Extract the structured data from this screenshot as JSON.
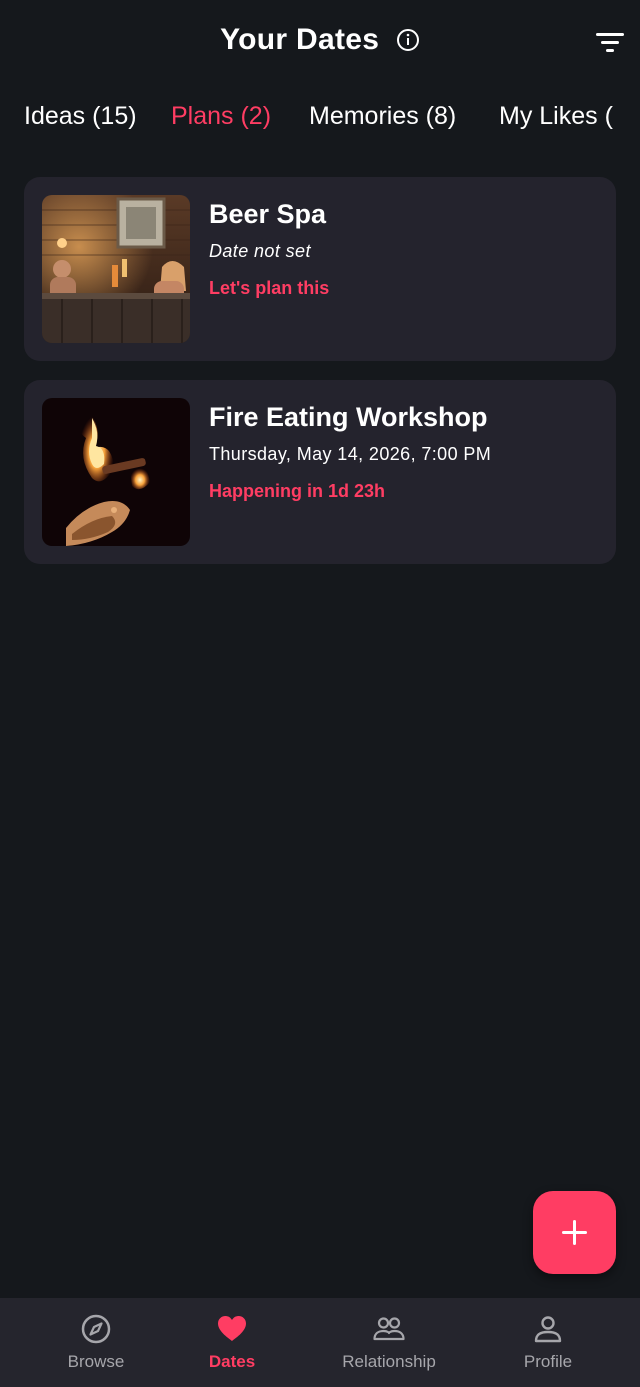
{
  "header": {
    "title": "Your Dates",
    "info_icon": "info-circle-icon",
    "filter_icon": "filter-icon"
  },
  "tabs": [
    {
      "label": "Ideas (15)",
      "active": false
    },
    {
      "label": "Plans (2)",
      "active": true
    },
    {
      "label": "Memories (8)",
      "active": false
    },
    {
      "label": "My Likes (",
      "active": false
    }
  ],
  "plans": [
    {
      "title": "Beer Spa",
      "date": "Date not set",
      "status": "Let's plan this",
      "image": "beer-spa-photo"
    },
    {
      "title": "Fire Eating Workshop",
      "date": "Thursday, May 14, 2026, 7:00 PM",
      "status": "Happening in 1d 23h",
      "image": "fire-eating-photo"
    }
  ],
  "fab": {
    "icon": "plus-icon"
  },
  "bottom_nav": [
    {
      "label": "Browse",
      "icon": "compass-icon",
      "active": false
    },
    {
      "label": "Dates",
      "icon": "heart-icon",
      "active": true
    },
    {
      "label": "Relationship",
      "icon": "people-icon",
      "active": false
    },
    {
      "label": "Profile",
      "icon": "person-icon",
      "active": false
    }
  ],
  "colors": {
    "background": "#15181c",
    "card": "#24232d",
    "accent": "#ff3d63",
    "nav_bg": "#25252d",
    "nav_inactive": "#a6a6ab"
  }
}
